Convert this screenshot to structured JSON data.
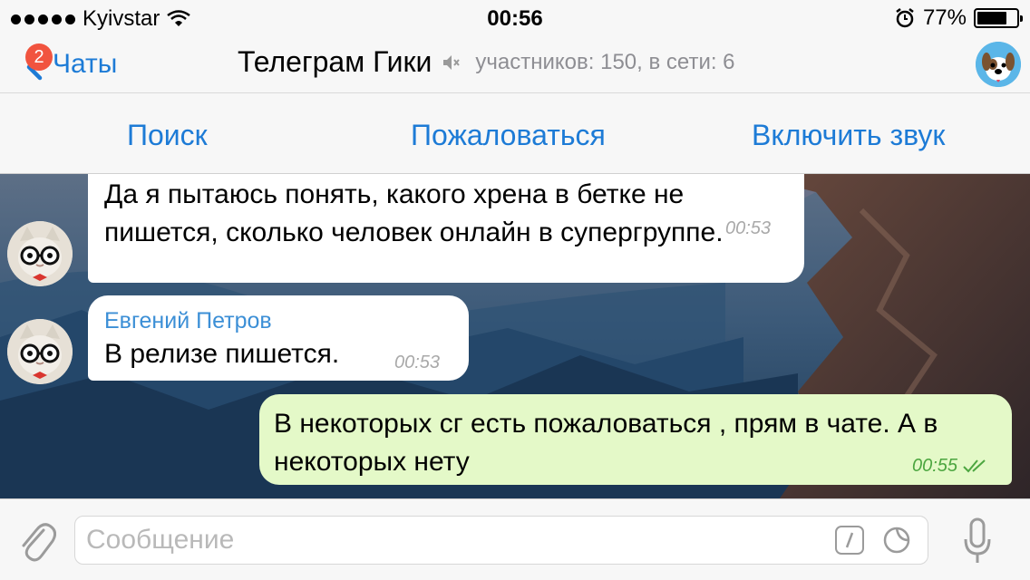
{
  "status_bar": {
    "carrier": "Kyivstar",
    "time": "00:56",
    "battery_percent_label": "77%",
    "battery_level": 0.77,
    "icons": [
      "signal-dots-icon",
      "wifi-icon",
      "alarm-icon",
      "battery-icon"
    ]
  },
  "nav": {
    "back_label": "Чаты",
    "unread_badge": "2",
    "title": "Телеграм Гики",
    "subtitle": "участников: 150, в сети: 6",
    "muted_icon": "speaker-muted-icon",
    "avatar_icon": "dog-avatar-icon"
  },
  "actions": {
    "search": "Поиск",
    "report": "Пожаловаться",
    "unmute": "Включить звук"
  },
  "messages": [
    {
      "direction": "incoming",
      "line1": "Да я пытаюсь понять, какого хрена в бетке не",
      "line2": "пишется, сколько человек онлайн в супергруппе.",
      "time": "00:53"
    },
    {
      "direction": "incoming",
      "sender": "Евгений Петров",
      "text": "В релизе пишется.",
      "time": "00:53"
    },
    {
      "direction": "outgoing",
      "line1": "В некоторых сг есть пожаловаться , прям в чате. А в",
      "line2": "некоторых нету",
      "time": "00:55",
      "status_icon": "double-check-icon"
    }
  ],
  "composer": {
    "placeholder": "Сообщение",
    "icons": [
      "paperclip-icon",
      "slash-command-icon",
      "sticker-icon",
      "microphone-icon"
    ]
  },
  "colors": {
    "accent": "#1d7bd6",
    "badge": "#f1543f",
    "outgoing_bubble": "#e4f9c8",
    "sender_name": "#3c8fd6"
  }
}
